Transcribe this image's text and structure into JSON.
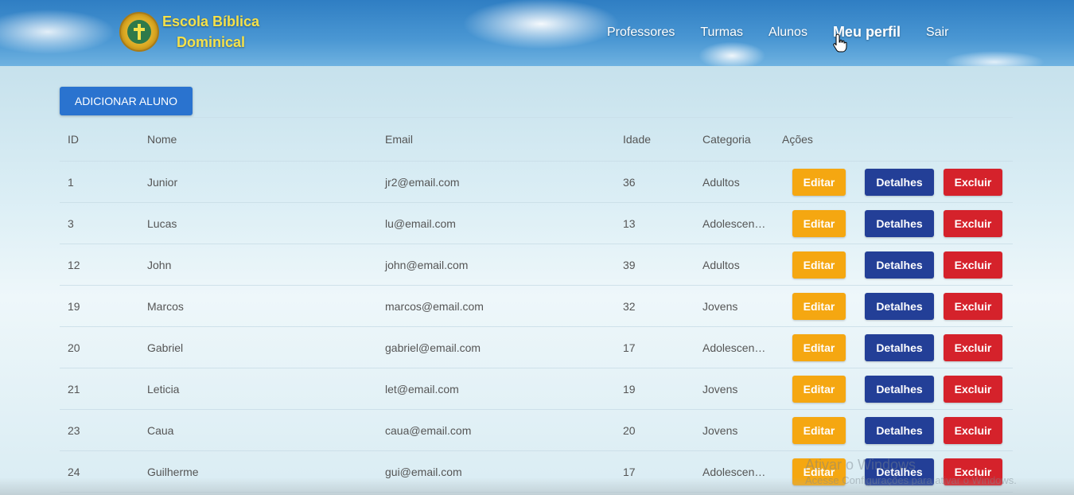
{
  "brand": {
    "line1": "Escola Bíblica",
    "line2": "Dominical"
  },
  "nav": {
    "items": [
      {
        "label": "Professores"
      },
      {
        "label": "Turmas"
      },
      {
        "label": "Alunos"
      },
      {
        "label": "Meu perfil"
      },
      {
        "label": "Sair"
      }
    ]
  },
  "add_button": "ADICIONAR ALUNO",
  "table": {
    "headers": [
      "ID",
      "Nome",
      "Email",
      "Idade",
      "Categoria",
      "Ações"
    ],
    "action_labels": {
      "edit": "Editar",
      "details": "Detalhes",
      "delete": "Excluir"
    },
    "rows": [
      {
        "id": "1",
        "nome": "Junior",
        "email": "jr2@email.com",
        "idade": "36",
        "categoria": "Adultos"
      },
      {
        "id": "3",
        "nome": "Lucas",
        "email": "lu@email.com",
        "idade": "13",
        "categoria": "Adolescentes"
      },
      {
        "id": "12",
        "nome": "John",
        "email": "john@email.com",
        "idade": "39",
        "categoria": "Adultos"
      },
      {
        "id": "19",
        "nome": "Marcos",
        "email": "marcos@email.com",
        "idade": "32",
        "categoria": "Jovens"
      },
      {
        "id": "20",
        "nome": "Gabriel",
        "email": "gabriel@email.com",
        "idade": "17",
        "categoria": "Adolescentes"
      },
      {
        "id": "21",
        "nome": "Leticia",
        "email": "let@email.com",
        "idade": "19",
        "categoria": "Jovens"
      },
      {
        "id": "23",
        "nome": "Caua",
        "email": "caua@email.com",
        "idade": "20",
        "categoria": "Jovens"
      },
      {
        "id": "24",
        "nome": "Guilherme",
        "email": "gui@email.com",
        "idade": "17",
        "categoria": "Adolescentes"
      }
    ]
  },
  "watermark": {
    "line1": "Ativar o Windows",
    "line2": "Acesse Configurações para ativar o Windows."
  },
  "colors": {
    "edit": "#f5a711",
    "details": "#233f97",
    "delete": "#d5222b",
    "primary": "#2a73cf"
  }
}
